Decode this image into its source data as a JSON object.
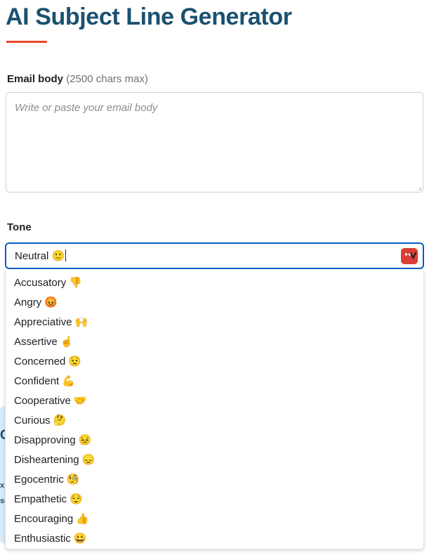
{
  "page": {
    "title": "AI Subject Line Generator",
    "accent_color": "#e8452f",
    "title_color": "#1b5170"
  },
  "email_body": {
    "label_strong": "Email body",
    "label_hint": "(2500 chars max)",
    "placeholder": "Write or paste your email body",
    "value": ""
  },
  "tone": {
    "label": "Tone",
    "value": "Neutral 🙂",
    "toggle_icon": "dropdown-chevron-icon",
    "toggle_color": "#d93f38",
    "focus_border_color": "#0b5bc4",
    "expanded": true,
    "options": [
      {
        "label": "Accusatory",
        "emoji": "👎"
      },
      {
        "label": "Angry",
        "emoji": "😡"
      },
      {
        "label": "Appreciative",
        "emoji": "🙌"
      },
      {
        "label": "Assertive",
        "emoji": "☝️"
      },
      {
        "label": "Concerned",
        "emoji": "😟"
      },
      {
        "label": "Confident",
        "emoji": "💪"
      },
      {
        "label": "Cooperative",
        "emoji": "🤝"
      },
      {
        "label": "Curious",
        "emoji": "🤔"
      },
      {
        "label": "Disapproving",
        "emoji": "😣"
      },
      {
        "label": "Disheartening",
        "emoji": "😞"
      },
      {
        "label": "Egocentric",
        "emoji": "🧐"
      },
      {
        "label": "Empathetic",
        "emoji": "😌"
      },
      {
        "label": "Encouraging",
        "emoji": "👍"
      },
      {
        "label": "Enthusiastic",
        "emoji": "😀"
      }
    ]
  },
  "info_panel": {
    "background_color": "#d6eaf7",
    "heading": "C",
    "line1": "x",
    "line2": "sc"
  }
}
